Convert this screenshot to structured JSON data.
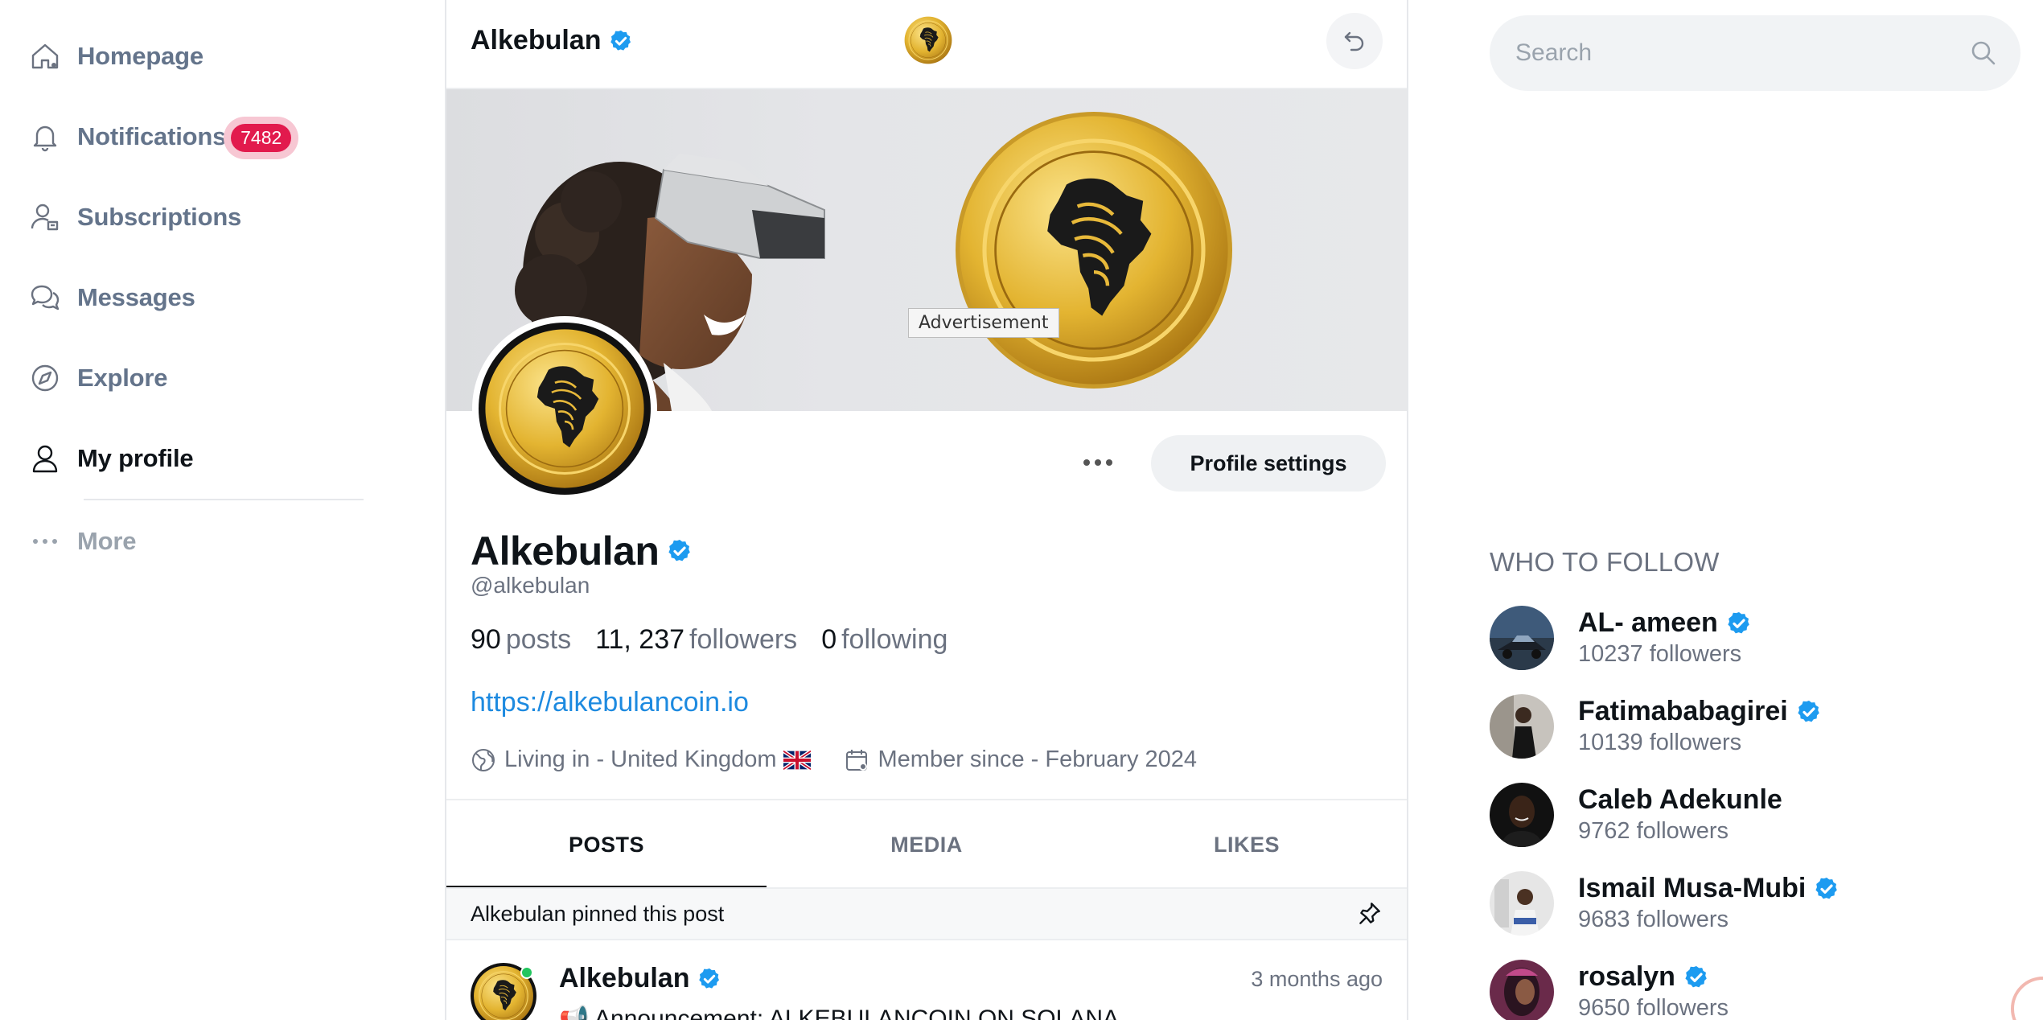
{
  "nav": {
    "items": [
      {
        "label": "Homepage"
      },
      {
        "label": "Notifications",
        "badge": "7482"
      },
      {
        "label": "Subscriptions"
      },
      {
        "label": "Messages"
      },
      {
        "label": "Explore"
      },
      {
        "label": "My profile"
      }
    ],
    "more_label": "More"
  },
  "topbar": {
    "title": "Alkebulan"
  },
  "cover": {
    "ad_label": "Advertisement"
  },
  "profile": {
    "name": "Alkebulan",
    "handle": "@alkebulan",
    "stats": {
      "posts_num": "90",
      "posts_label": "posts",
      "followers_num": "11, 237",
      "followers_label": "followers",
      "following_num": "0",
      "following_label": "following"
    },
    "website": "https://alkebulancoin.io",
    "location": "Living in - United Kingdom",
    "member_since": "Member since - February 2024",
    "settings_label": "Profile settings"
  },
  "tabs": [
    {
      "label": "POSTS"
    },
    {
      "label": "MEDIA"
    },
    {
      "label": "LIKES"
    }
  ],
  "pinned": {
    "label": "Alkebulan pinned this post"
  },
  "post": {
    "author": "Alkebulan",
    "time": "3 months ago",
    "text": "📢 Announcement: ALKEBULANCOIN ON SOLANA"
  },
  "search": {
    "placeholder": "Search"
  },
  "who_to_follow": {
    "title": "WHO TO FOLLOW",
    "users": [
      {
        "name": "AL- ameen",
        "followers": "10237 followers",
        "verified": true
      },
      {
        "name": "Fatimababagirei",
        "followers": "10139 followers",
        "verified": true
      },
      {
        "name": "Caleb Adekunle",
        "followers": "9762 followers",
        "verified": false
      },
      {
        "name": "Ismail Musa-Mubi",
        "followers": "9683 followers",
        "verified": true
      },
      {
        "name": "rosalyn",
        "followers": "9650 followers",
        "verified": true
      }
    ]
  },
  "colors": {
    "accent": "#1d8ae0",
    "badge": "#e21a4d",
    "verified": "#1d9bf0"
  }
}
